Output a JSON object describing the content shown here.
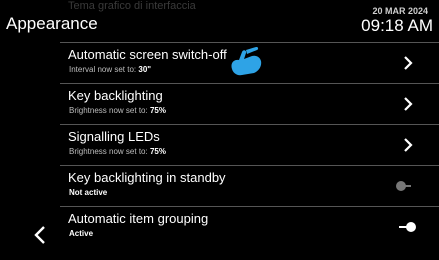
{
  "header": {
    "ghost_title": "Tema grafico di interfaccia",
    "title": "Appearance",
    "date": "20 MAR 2024",
    "time": "09:18 AM"
  },
  "settings": [
    {
      "label": "Automatic screen switch-off",
      "sub_prefix": "Interval now set to: ",
      "sub_value": "30\"",
      "control": "chevron"
    },
    {
      "label": "Key backlighting",
      "sub_prefix": "Brightness now set to: ",
      "sub_value": "75%",
      "control": "chevron"
    },
    {
      "label": "Signalling LEDs",
      "sub_prefix": "Brightness now set to: ",
      "sub_value": "75%",
      "control": "chevron"
    },
    {
      "label": "Key backlighting in standby",
      "sub_prefix": "",
      "sub_value": "Not active",
      "control": "toggle-off"
    },
    {
      "label": "Automatic item grouping",
      "sub_prefix": "",
      "sub_value": "Active",
      "control": "toggle-on"
    }
  ],
  "icons": {
    "back": "chevron-left-icon",
    "row_chevron": "chevron-right-icon",
    "pointer": "hand-pointer-icon"
  },
  "colors": {
    "background": "#000000",
    "accent_pointer": "#2ea3e6",
    "divider": "#555555"
  }
}
